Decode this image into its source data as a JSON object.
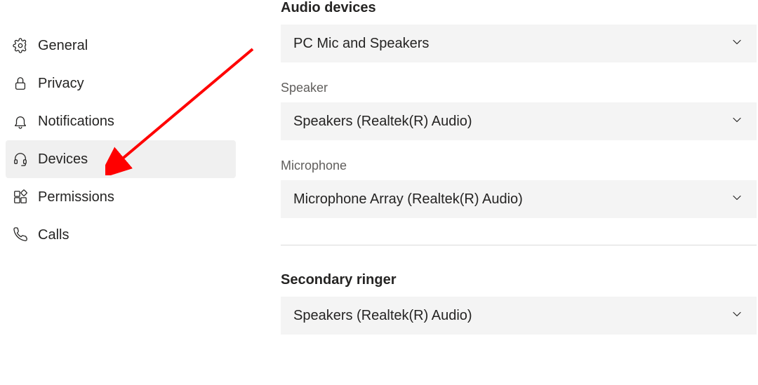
{
  "sidebar": {
    "items": [
      {
        "label": "General"
      },
      {
        "label": "Privacy"
      },
      {
        "label": "Notifications"
      },
      {
        "label": "Devices"
      },
      {
        "label": "Permissions"
      },
      {
        "label": "Calls"
      }
    ],
    "selected_index": 3
  },
  "main": {
    "sections": {
      "audio_devices": {
        "title": "Audio devices",
        "primary_value": "PC Mic and Speakers",
        "speaker_label": "Speaker",
        "speaker_value": "Speakers (Realtek(R) Audio)",
        "microphone_label": "Microphone",
        "microphone_value": "Microphone Array (Realtek(R) Audio)"
      },
      "secondary_ringer": {
        "title": "Secondary ringer",
        "value": "Speakers (Realtek(R) Audio)"
      }
    }
  },
  "annotation": {
    "arrow_color": "#ff0000"
  }
}
